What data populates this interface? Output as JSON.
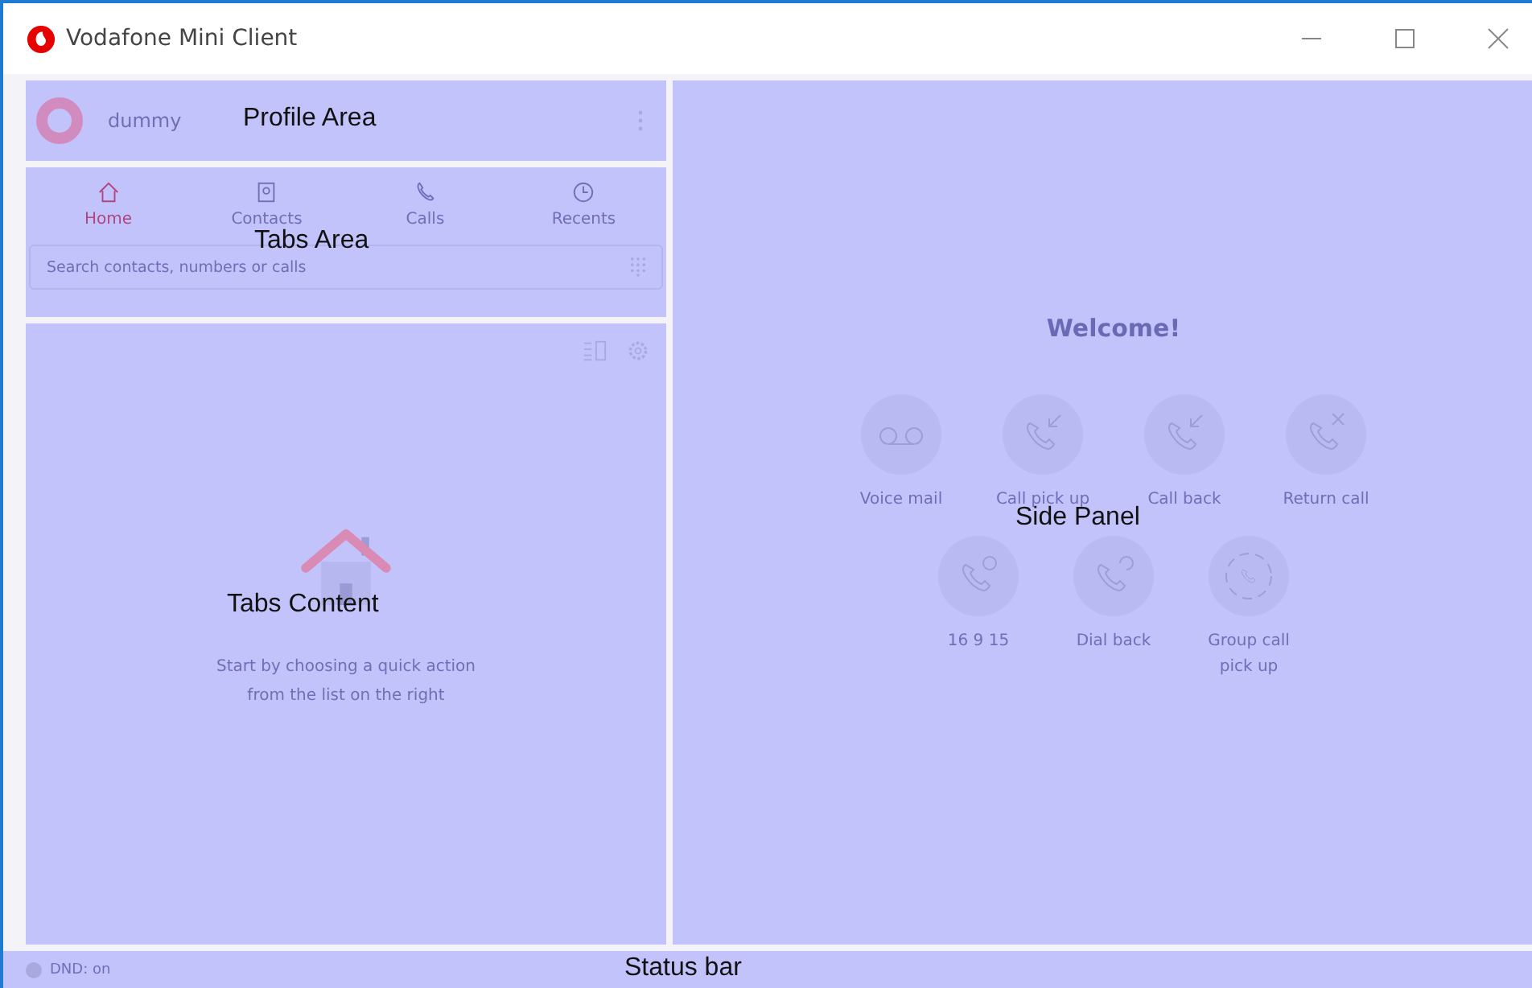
{
  "window": {
    "title": "Vodafone Mini Client"
  },
  "profile": {
    "name": "dummy",
    "overlay_label": "Profile Area"
  },
  "tabs_area": {
    "overlay_label": "Tabs Area",
    "tabs": [
      {
        "label": "Home",
        "kind": "home",
        "selected": true
      },
      {
        "label": "Contacts",
        "kind": "contacts",
        "selected": false
      },
      {
        "label": "Calls",
        "kind": "calls",
        "selected": false
      },
      {
        "label": "Recents",
        "kind": "recents",
        "selected": false
      }
    ],
    "search": {
      "placeholder": "Search contacts, numbers or calls"
    }
  },
  "tabs_content": {
    "overlay_label": "Tabs Content",
    "message": "Start by choosing a quick action from the list on the right"
  },
  "side_panel": {
    "overlay_label": "Side Panel",
    "heading": "Welcome!",
    "action_rows": [
      [
        {
          "label": "Voice mail",
          "kind": "voicemail"
        },
        {
          "label": "Call pick up",
          "kind": "pickup"
        },
        {
          "label": "Call back",
          "kind": "callback"
        },
        {
          "label": "Return call",
          "kind": "return"
        }
      ],
      [
        {
          "label": "16 9 15",
          "kind": "number"
        },
        {
          "label": "Dial back",
          "kind": "dialback"
        },
        {
          "label": "Group call pick up",
          "kind": "group"
        }
      ]
    ]
  },
  "status_bar": {
    "status": "DND: on",
    "overlay_label": "Status bar"
  }
}
